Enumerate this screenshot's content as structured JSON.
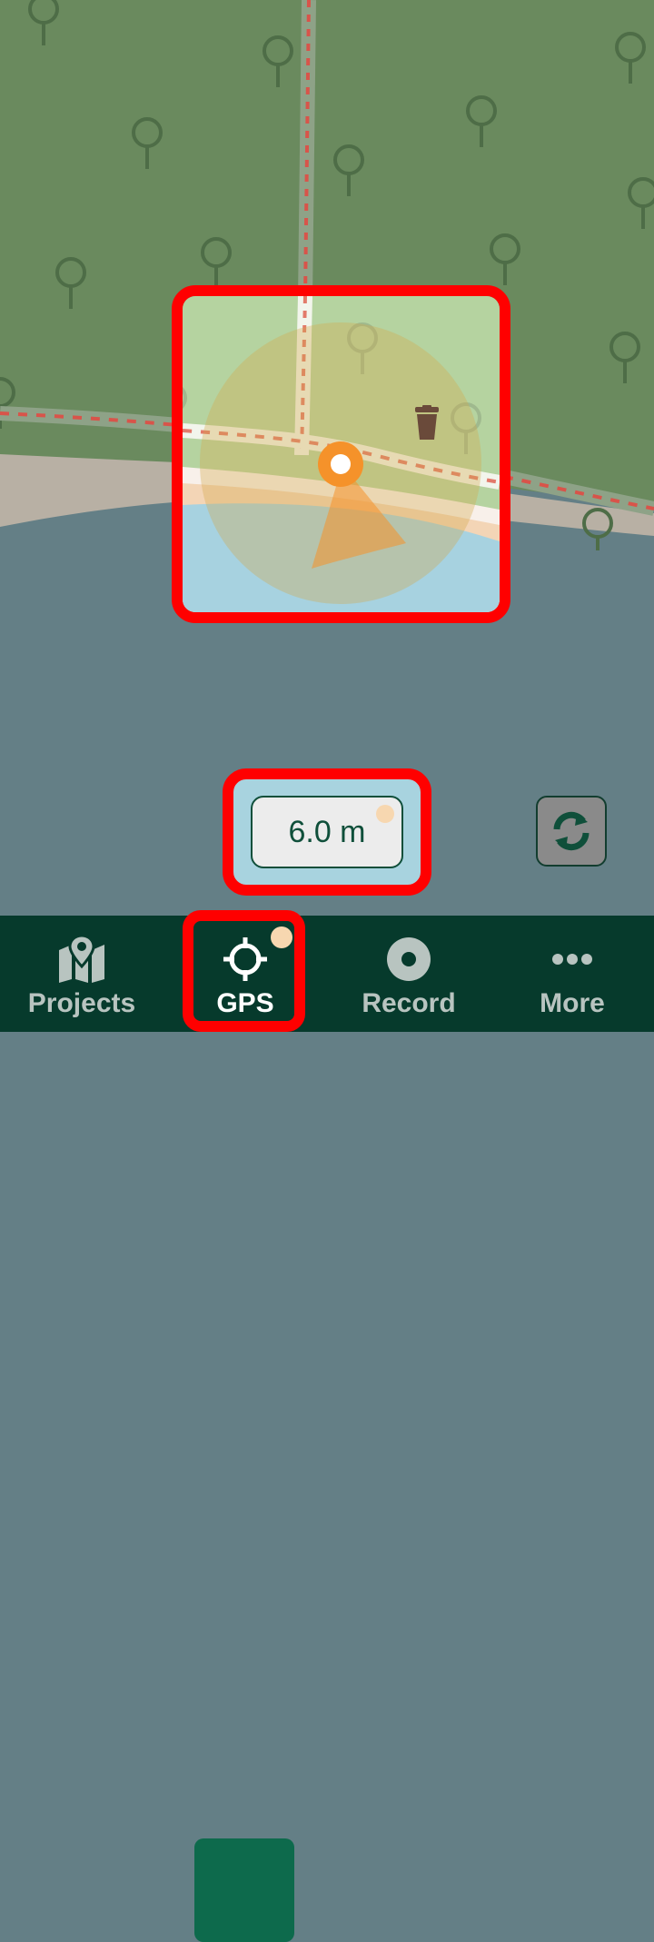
{
  "map": {
    "colors": {
      "forest": "#6a8a5e",
      "water": "#647f86",
      "beach": "#b9b1a6",
      "path": "#d8544a"
    },
    "location_marker": {
      "color": "#f5922a",
      "icon": "location-pin-icon"
    },
    "poi": {
      "icon": "waste-basket-icon"
    }
  },
  "accuracy": {
    "value": "6.0 m"
  },
  "refresh": {
    "icon": "refresh-icon"
  },
  "tabs": [
    {
      "label": "Projects",
      "icon": "map-pin-icon",
      "active": false
    },
    {
      "label": "GPS",
      "icon": "crosshair-icon",
      "active": true
    },
    {
      "label": "Record",
      "icon": "record-icon",
      "active": false
    },
    {
      "label": "More",
      "icon": "more-dots-icon",
      "active": false
    }
  ]
}
